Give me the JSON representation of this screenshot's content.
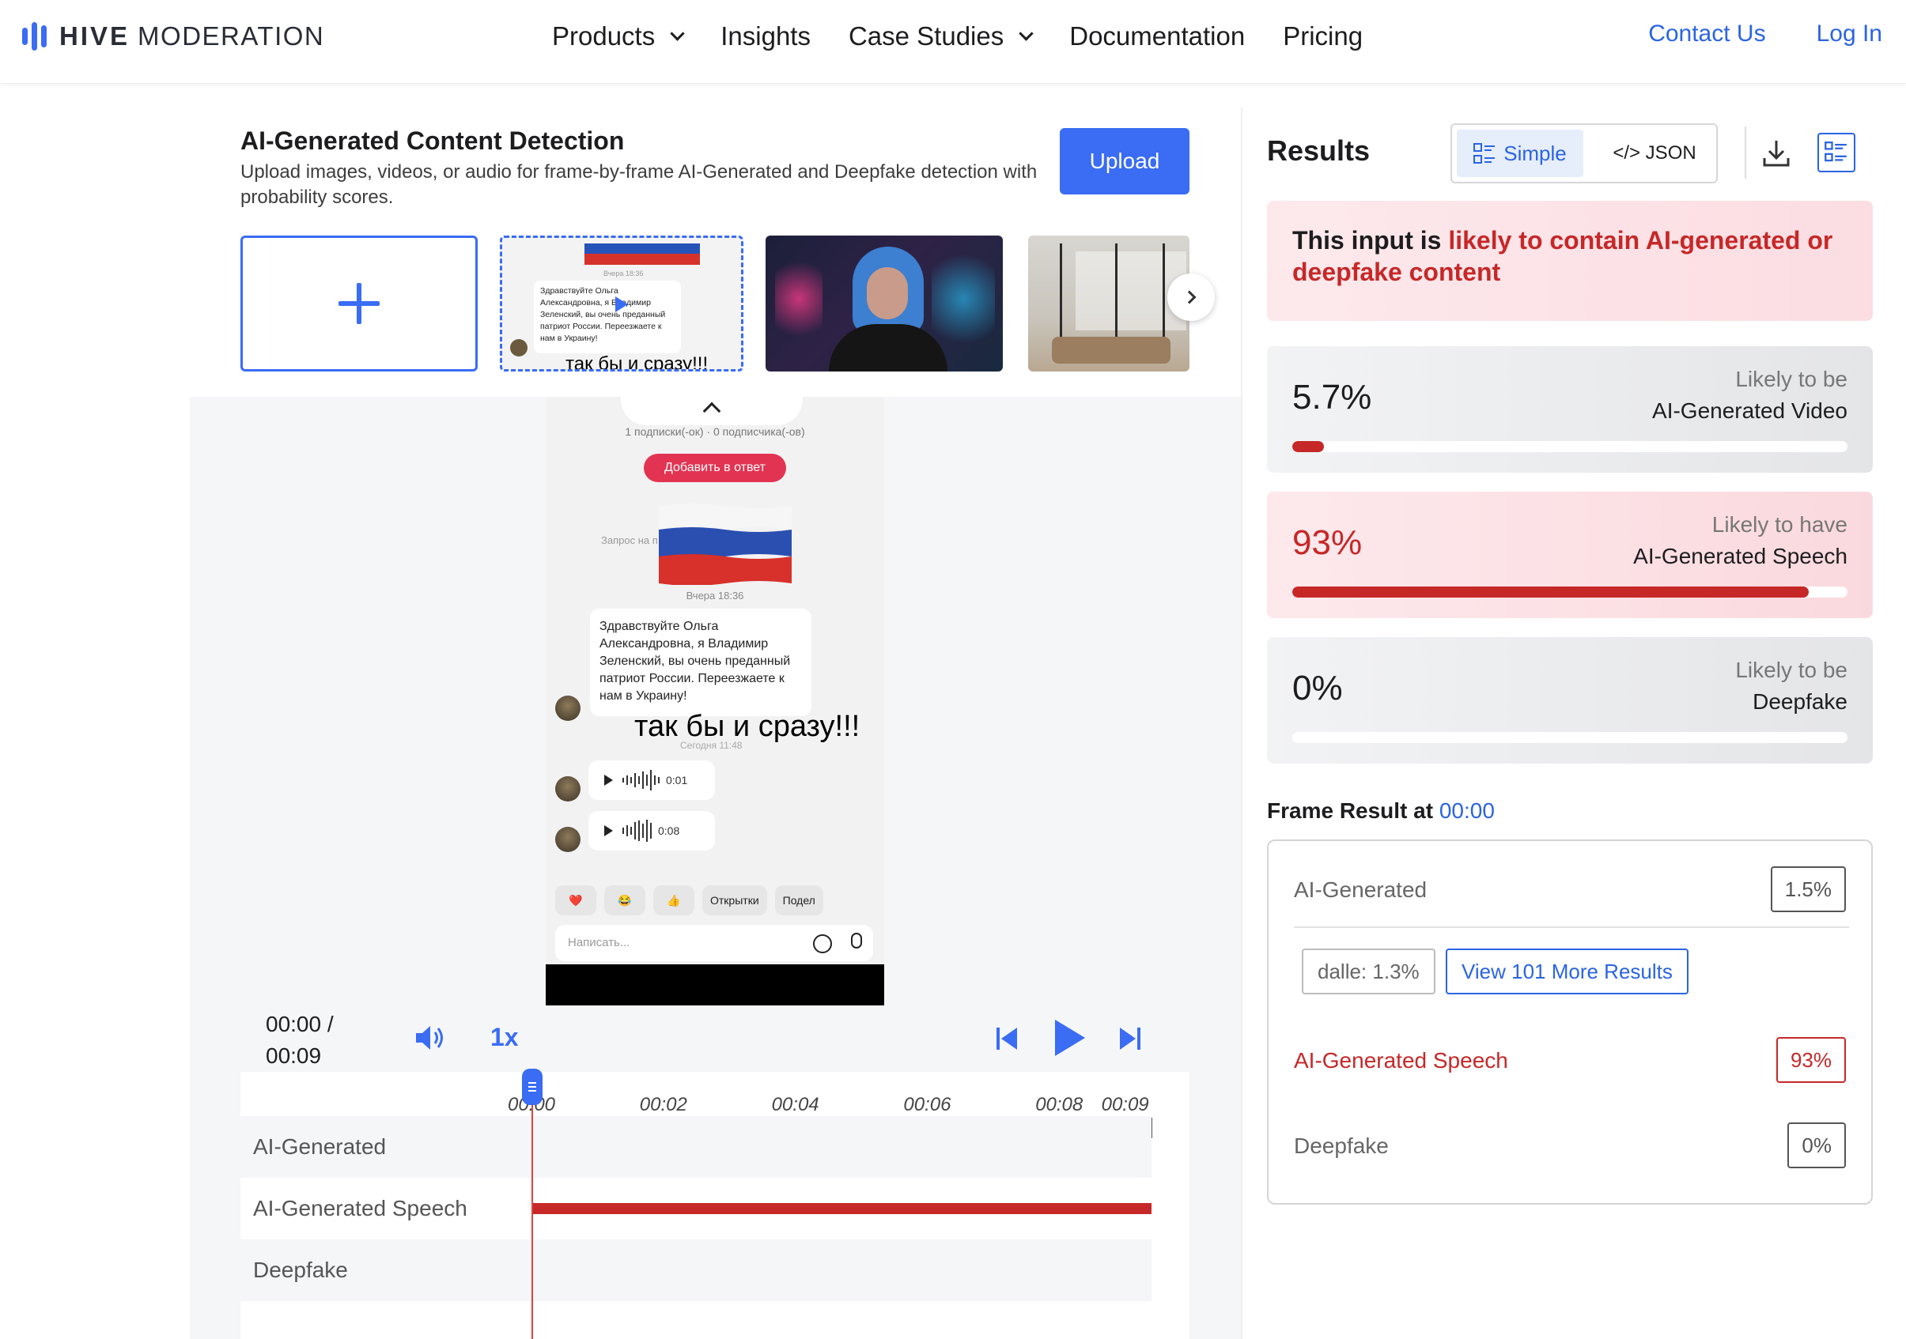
{
  "nav": {
    "brand_bold": "HIVE",
    "brand_light": "MODERATION",
    "links": [
      "Products",
      "Insights",
      "Case Studies",
      "Documentation",
      "Pricing"
    ],
    "contact": "Contact Us",
    "login": "Log In"
  },
  "header": {
    "title": "AI-Generated Content Detection",
    "subtitle": "Upload images, videos, or audio for frame-by-frame AI-Generated and Deepfake detection with probability scores.",
    "upload_label": "Upload"
  },
  "thumbnail_chat": {
    "time": "Вчера 18:36",
    "message": "Здравствуйте Ольга Александровна, я Владимир Зеленский, вы очень преданный патриот России. Переезжаете к нам в Украину!",
    "caption": "так бы и сразу!!!"
  },
  "video": {
    "subscribers": "1 подписки(-ок) · 0 подписчика(-ов)",
    "add_reply": "Добавить в ответ",
    "request": "Запрос на п",
    "time1": "Вчера 18:36",
    "message": "Здравствуйте Ольга Александровна, я Владимир Зеленский, вы очень преданный патриот России. Переезжаете к нам в Украину!",
    "caption": "так бы и сразу!!!",
    "time2": "Сегодня 11:48",
    "voice1": "0:01",
    "voice2": "0:08",
    "reactions": [
      "❤️",
      "😂",
      "👍",
      "Открытки",
      "Подел"
    ],
    "input_placeholder": "Написать..."
  },
  "player": {
    "time_current": "00:00 /",
    "time_total": "00:09",
    "speed": "1x",
    "timeline_labels": [
      "00:00",
      "00:02",
      "00:04",
      "00:06",
      "00:08",
      "00:09"
    ],
    "rows": [
      "AI-Generated",
      "AI-Generated Speech",
      "Deepfake"
    ]
  },
  "results": {
    "title": "Results",
    "toggle_simple": "Simple",
    "toggle_json": "</> JSON",
    "alert_prefix": "This input is ",
    "alert_highlight": "likely to contain AI-generated or deepfake content",
    "cards": [
      {
        "pct": "5.7%",
        "value": 5.7,
        "line1": "Likely to be",
        "line2": "AI-Generated Video",
        "flagged": false
      },
      {
        "pct": "93%",
        "value": 93,
        "line1": "Likely to have",
        "line2": "AI-Generated Speech",
        "flagged": true
      },
      {
        "pct": "0%",
        "value": 0,
        "line1": "Likely to be",
        "line2": "Deepfake",
        "flagged": false
      }
    ],
    "frame_title": "Frame Result at ",
    "frame_time": "00:00",
    "frame": {
      "ai_generated": "AI-Generated",
      "ai_generated_pct": "1.5%",
      "chip_dalle": "dalle: 1.3%",
      "chip_more": "View 101 More Results",
      "speech": "AI-Generated Speech",
      "speech_pct": "93%",
      "deepfake": "Deepfake",
      "deepfake_pct": "0%"
    }
  },
  "colors": {
    "accent": "#3a6cf4",
    "link": "#2b64e3",
    "danger": "#c62828"
  }
}
